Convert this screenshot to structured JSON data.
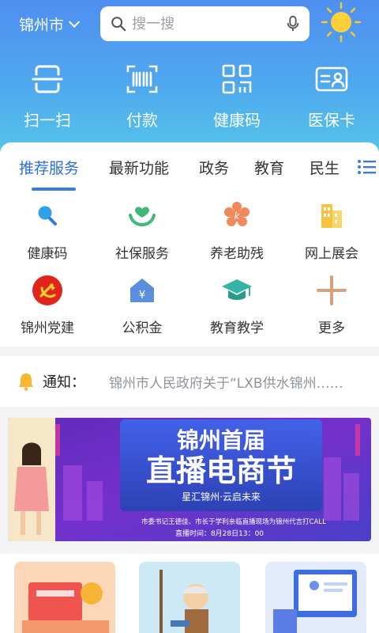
{
  "header": {
    "city": "锦州市",
    "search_placeholder": "搜一搜"
  },
  "quick_actions": [
    {
      "label": "扫一扫",
      "icon": "scan-icon"
    },
    {
      "label": "付款",
      "icon": "barcode-icon"
    },
    {
      "label": "健康码",
      "icon": "qr-code-icon"
    },
    {
      "label": "医保卡",
      "icon": "medical-card-icon"
    }
  ],
  "tabs": [
    {
      "label": "推荐服务",
      "active": true
    },
    {
      "label": "最新功能"
    },
    {
      "label": "政务"
    },
    {
      "label": "教育"
    },
    {
      "label": "民生"
    }
  ],
  "services": [
    {
      "label": "健康码",
      "icon": "magnifier-icon"
    },
    {
      "label": "社保服务",
      "icon": "hands-heart-icon"
    },
    {
      "label": "养老助残",
      "icon": "elderly-care-icon"
    },
    {
      "label": "网上展会",
      "icon": "buildings-icon"
    },
    {
      "label": "锦州党建",
      "icon": "party-emblem-icon"
    },
    {
      "label": "公积金",
      "icon": "house-fund-icon"
    },
    {
      "label": "教育教学",
      "icon": "graduation-cap-icon"
    },
    {
      "label": "更多",
      "icon": "plus-icon"
    }
  ],
  "notice": {
    "label": "通知：",
    "text": "锦州市人民政府关于“LXB供水锦州……"
  },
  "banner": {
    "title_line1": "锦州首届",
    "title_line2": "直播电商节",
    "tagline": "星汇锦州·云启未来",
    "caption": "市委书记王德佳、市长于学利亲临直播现场为锦州代言打CALL",
    "time": "直播时间：8月28日13：00"
  },
  "colors": {
    "accent": "#2b6fd6",
    "header_top": "#4f8ff1",
    "header_bottom": "#55c7ea"
  }
}
